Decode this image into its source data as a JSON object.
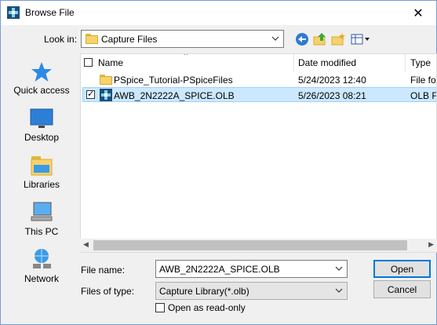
{
  "window": {
    "title": "Browse File",
    "close_glyph": "✕"
  },
  "look_in": {
    "label": "Look in:",
    "value": "Capture Files"
  },
  "toolbar_icons": [
    "back-icon",
    "up-folder-icon",
    "new-folder-icon",
    "view-menu-icon"
  ],
  "places": [
    {
      "label": "Quick access",
      "icon": "star-icon"
    },
    {
      "label": "Desktop",
      "icon": "desktop-icon"
    },
    {
      "label": "Libraries",
      "icon": "libraries-icon"
    },
    {
      "label": "This PC",
      "icon": "computer-icon"
    },
    {
      "label": "Network",
      "icon": "network-icon"
    }
  ],
  "columns": {
    "name": "Name",
    "date": "Date modified",
    "type": "Type"
  },
  "rows": [
    {
      "name": "PSpice_Tutorial-PSpiceFiles",
      "date": "5/24/2023 12:40",
      "type": "File fo",
      "icon": "folder-icon",
      "selected": false
    },
    {
      "name": "AWB_2N2222A_SPICE.OLB",
      "date": "5/26/2023 08:21",
      "type": "OLB F",
      "icon": "olb-file-icon",
      "selected": true
    }
  ],
  "file_name": {
    "label": "File name:",
    "value": "AWB_2N2222A_SPICE.OLB"
  },
  "file_type": {
    "label": "Files of type:",
    "value": "Capture Library(*.olb)"
  },
  "read_only": {
    "label": "Open as read-only",
    "checked": false
  },
  "buttons": {
    "open": "Open",
    "cancel": "Cancel"
  },
  "colors": {
    "selection": "#cce8ff",
    "accent": "#0078d7",
    "folder": "#f7d26b"
  }
}
